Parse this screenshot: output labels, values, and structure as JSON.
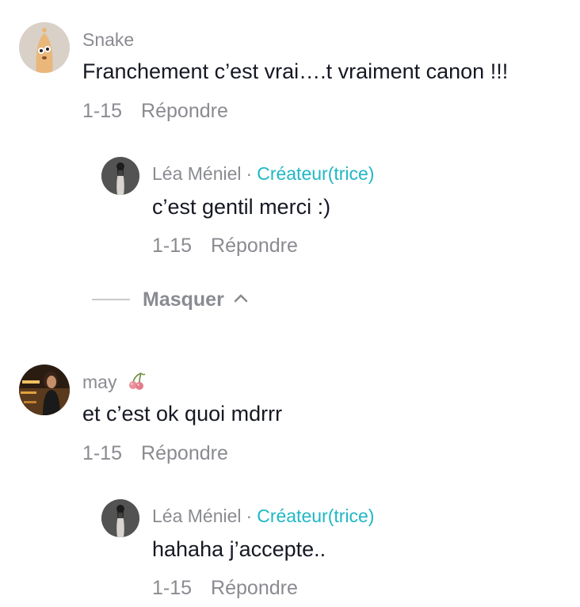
{
  "comments": [
    {
      "username": "Snake",
      "text": "Franchement c’est vrai….t vraiment canon !!!",
      "date": "1-15",
      "reply_label": "Répondre",
      "reply": {
        "username": "Léa Méniel",
        "separator": "·",
        "badge": "Créateur(trice)",
        "text": "c’est gentil merci :)",
        "date": "1-15",
        "reply_label": "Répondre"
      }
    },
    {
      "username": "may",
      "username_emoji": "cherries-icon",
      "text": "et c’est ok quoi mdrrr",
      "date": "1-15",
      "reply_label": "Répondre",
      "reply": {
        "username": "Léa Méniel",
        "separator": "·",
        "badge": "Créateur(trice)",
        "text": "hahaha j’accepte..",
        "date": "1-15",
        "reply_label": "Répondre"
      }
    }
  ],
  "thread_toggle": {
    "label": "Masquer",
    "icon": "chevron-up-icon"
  },
  "colors": {
    "username": "#8a8b91",
    "creator_badge": "#20b7c5",
    "text": "#161823",
    "meta": "#8a8b91"
  }
}
